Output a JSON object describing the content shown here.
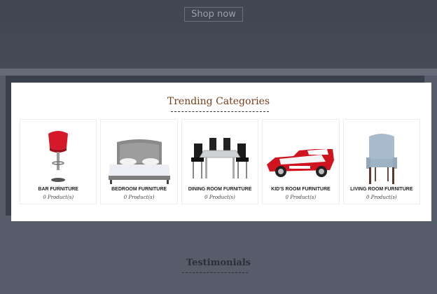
{
  "hero": {
    "shop_button": "Shop now"
  },
  "trending": {
    "title": "Trending Categories",
    "categories": [
      {
        "name": "BAR FURNITURE",
        "count": "0 Product(s)",
        "icon": "bar-stool-icon"
      },
      {
        "name": "BEDROOM FURNITURE",
        "count": "0 Product(s)",
        "icon": "bed-icon"
      },
      {
        "name": "DINING ROOM FURNITURE",
        "count": "0 Product(s)",
        "icon": "dining-set-icon"
      },
      {
        "name": "KID'S ROOM FURNITURE",
        "count": "0 Product(s)",
        "icon": "race-car-bed-icon"
      },
      {
        "name": "LIVING ROOM FURNITURE",
        "count": "0 Product(s)",
        "icon": "armchair-icon"
      }
    ]
  },
  "testimonials": {
    "title": "Testimonials"
  },
  "colors": {
    "title_accent": "#7a3d1b",
    "background": "#565c69"
  }
}
